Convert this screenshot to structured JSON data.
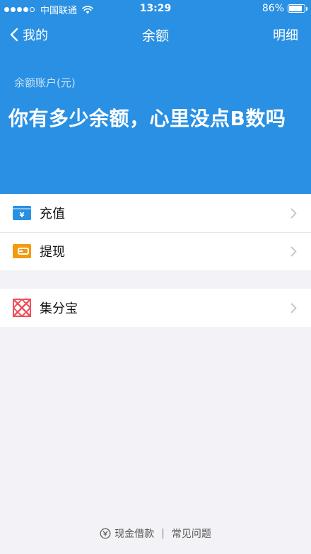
{
  "status_bar": {
    "carrier": "中国联通",
    "time": "13:29",
    "battery": "86%",
    "battery_level": 0.86
  },
  "nav": {
    "back_label": "我的",
    "title": "余额",
    "detail_label": "明细"
  },
  "balance": {
    "caption": "余额账户(元)",
    "amount_text": "你有多少余额，心里没点B数吗"
  },
  "actions": [
    {
      "label": "充值",
      "icon": "wallet-yen-icon"
    },
    {
      "label": "提现",
      "icon": "wallet-withdraw-icon"
    }
  ],
  "services": [
    {
      "label": "集分宝",
      "icon": "jifenbao-icon"
    }
  ],
  "footer": {
    "cash_loan": "现金借款",
    "separator": "|",
    "faq": "常见问题"
  },
  "colors": {
    "header_bg": "#2a90e3",
    "recharge_icon": "#2a90e3",
    "withdraw_icon": "#f29a10",
    "jifenbao_icon": "#ef4f5c"
  }
}
